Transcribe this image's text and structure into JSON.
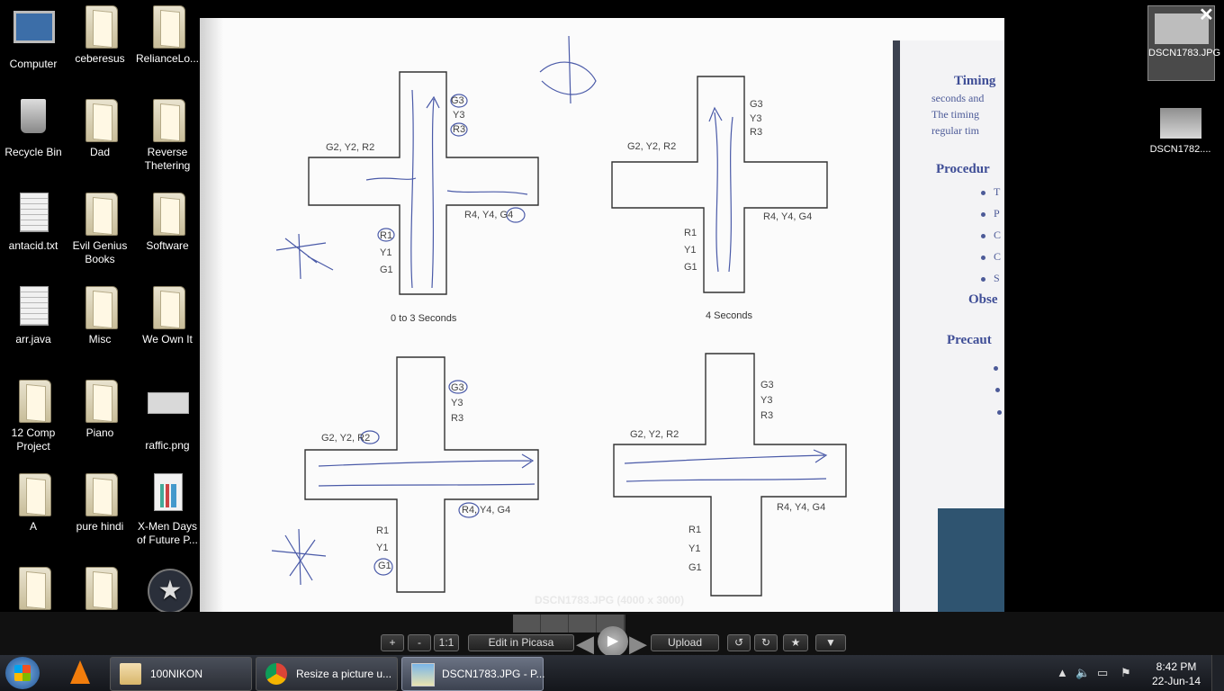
{
  "desktop": {
    "icons": [
      {
        "label": "Computer",
        "kind": "computer"
      },
      {
        "label": "ceberesus",
        "kind": "folder"
      },
      {
        "label": "RelianceLo...",
        "kind": "folder"
      },
      {
        "label": "Recycle Bin",
        "kind": "bin"
      },
      {
        "label": "Dad",
        "kind": "folder"
      },
      {
        "label": "Reverse Thetering",
        "kind": "folder"
      },
      {
        "label": "antacid.txt",
        "kind": "doc"
      },
      {
        "label": "Evil Genius Books",
        "kind": "folder"
      },
      {
        "label": "Software",
        "kind": "folder"
      },
      {
        "label": "arr.java",
        "kind": "doc"
      },
      {
        "label": "Misc",
        "kind": "folder"
      },
      {
        "label": "We Own It",
        "kind": "folder"
      },
      {
        "label": "12 Comp Project",
        "kind": "folder"
      },
      {
        "label": "Piano",
        "kind": "folder"
      },
      {
        "label": "raffic.png",
        "kind": "image"
      },
      {
        "label": "A",
        "kind": "folder"
      },
      {
        "label": "pure hindi",
        "kind": "folder"
      },
      {
        "label": "X-Men Days of Future P...",
        "kind": "chart"
      }
    ]
  },
  "photo": {
    "diagram": {
      "top_left": {
        "north": [
          "G3",
          "Y3",
          "R3"
        ],
        "west": "G2, Y2, R2",
        "east": "R4, Y4, G4",
        "south": [
          "R1",
          "Y1",
          "G1"
        ],
        "caption": "0 to 3 Seconds"
      },
      "top_right": {
        "north": [
          "G3",
          "Y3",
          "R3"
        ],
        "west": "G2, Y2, R2",
        "east": "R4, Y4, G4",
        "south": [
          "R1",
          "Y1",
          "G1"
        ],
        "caption": "4 Seconds"
      },
      "bottom_left": {
        "north": [
          "G3",
          "Y3",
          "R3"
        ],
        "west": "G2, Y2, R2",
        "east": "R4, Y4, G4",
        "south": [
          "R1",
          "Y1",
          "G1"
        ]
      },
      "bottom_right": {
        "north": [
          "G3",
          "Y3",
          "R3"
        ],
        "west": "G2, Y2, R2",
        "east": "R4, Y4, G4",
        "south": [
          "R1",
          "Y1",
          "G1"
        ]
      }
    },
    "book_text": {
      "timing": "Timing",
      "line1": "seconds and",
      "line2": "The timing",
      "line3": "regular tim",
      "procedure": "Procedur",
      "bullets": [
        "T",
        "P",
        "C",
        "C",
        "S"
      ],
      "observation": "Obse",
      "precautions": "Precaut"
    }
  },
  "viewer": {
    "title": "DSCN1783.JPG (4000 x 3000)",
    "thumbnails": [
      {
        "label": "DSCN1783.JPG",
        "selected": true
      },
      {
        "label": "DSCN1782....",
        "selected": false
      }
    ],
    "controls": {
      "zoom_in": "+",
      "zoom_out": "-",
      "actual": "1:1",
      "edit": "Edit in Picasa",
      "upload": "Upload",
      "rotate_left": "↺",
      "rotate_right": "↻",
      "star": "★",
      "more": "▼",
      "play": "▶"
    },
    "close": "✕"
  },
  "taskbar": {
    "tasks": [
      {
        "label": "100NIKON",
        "active": false
      },
      {
        "label": "Resize a picture u...",
        "active": false
      },
      {
        "label": "DSCN1783.JPG - P...",
        "active": true
      }
    ],
    "time": "8:42 PM",
    "date": "22-Jun-14"
  },
  "colors": {
    "accent_blue": "#3e4d96",
    "pen_blue": "#4a5aa8"
  }
}
